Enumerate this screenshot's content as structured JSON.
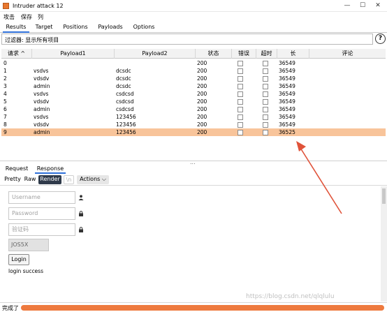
{
  "window": {
    "title": "Intruder attack 12",
    "accent": "#2e6fd8"
  },
  "menu": [
    "攻击",
    "保存",
    "列"
  ],
  "tabs": [
    {
      "label": "Results",
      "active": true
    },
    {
      "label": "Target",
      "active": false
    },
    {
      "label": "Positions",
      "active": false
    },
    {
      "label": "Payloads",
      "active": false
    },
    {
      "label": "Options",
      "active": false
    }
  ],
  "filter": {
    "text": "过滤器:  显示所有项目"
  },
  "help_label": "?",
  "table": {
    "columns": [
      "请求 ^",
      "Payload1",
      "Payload2",
      "状态",
      "错误",
      "超时",
      "长",
      "评论"
    ],
    "rows": [
      {
        "req": "0",
        "p1": "",
        "p2": "",
        "status": "200",
        "len": "36549"
      },
      {
        "req": "1",
        "p1": "vsdvs",
        "p2": "dcsdc",
        "status": "200",
        "len": "36549"
      },
      {
        "req": "2",
        "p1": "vdsdv",
        "p2": "dcsdc",
        "status": "200",
        "len": "36549"
      },
      {
        "req": "3",
        "p1": "admin",
        "p2": "dcsdc",
        "status": "200",
        "len": "36549"
      },
      {
        "req": "4",
        "p1": "vsdvs",
        "p2": "csdcsd",
        "status": "200",
        "len": "36549"
      },
      {
        "req": "5",
        "p1": "vdsdv",
        "p2": "csdcsd",
        "status": "200",
        "len": "36549"
      },
      {
        "req": "6",
        "p1": "admin",
        "p2": "csdcsd",
        "status": "200",
        "len": "36549"
      },
      {
        "req": "7",
        "p1": "vsdvs",
        "p2": "123456",
        "status": "200",
        "len": "36549"
      },
      {
        "req": "8",
        "p1": "vdsdv",
        "p2": "123456",
        "status": "200",
        "len": "36549"
      },
      {
        "req": "9",
        "p1": "admin",
        "p2": "123456",
        "status": "200",
        "len": "36525",
        "selected": true
      }
    ],
    "selected_color": "#f8c49a"
  },
  "splitter_dots": "...",
  "detail_tabs": [
    {
      "label": "Request",
      "active": false
    },
    {
      "label": "Response",
      "active": true
    }
  ],
  "view_buttons": {
    "pretty": "Pretty",
    "raw": "Raw",
    "render": "Render",
    "newline": "\\n",
    "actions": "Actions ⌵"
  },
  "render_page": {
    "username_placeholder": "Username",
    "password_placeholder": "Password",
    "captcha_placeholder": "验证码",
    "captcha_image_text": "JOS5X",
    "login_button": "Login",
    "message": "login success",
    "user_icon": "user-icon",
    "lock_icon": "lock-icon"
  },
  "watermark": "https://blog.csdn.net/qlqlulu",
  "annotation": {
    "color": "#e0533a"
  },
  "status": {
    "text": "完成了",
    "progress": 1.0,
    "color": "#ee7a3f"
  }
}
